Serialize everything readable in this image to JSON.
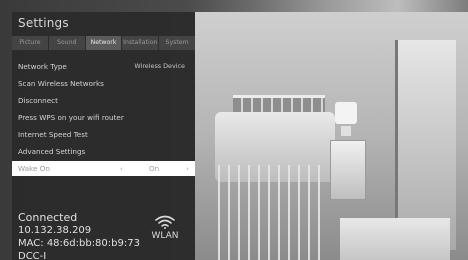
{
  "settings": {
    "title": "Settings",
    "tabs": [
      {
        "label": "Picture",
        "active": false
      },
      {
        "label": "Sound",
        "active": false
      },
      {
        "label": "Network",
        "active": true
      },
      {
        "label": "Installation",
        "active": false
      },
      {
        "label": "System",
        "active": false
      }
    ],
    "menu": [
      {
        "label": "Network Type",
        "value": "Wireless Device"
      },
      {
        "label": "Scan Wireless Networks",
        "value": ""
      },
      {
        "label": "Disconnect",
        "value": ""
      },
      {
        "label": "Press WPS on your wifi router",
        "value": ""
      },
      {
        "label": "Internet Speed Test",
        "value": ""
      },
      {
        "label": "Advanced Settings",
        "value": ""
      }
    ],
    "wake_on": {
      "label": "Wake On",
      "left_arrow": "‹",
      "value": "On",
      "right_arrow": "›"
    },
    "status": {
      "connection": "Connected",
      "ip": "10.132.38.209",
      "mac": "MAC: 48:6d:bb:80:b9:73",
      "partial_line": "DCC-I",
      "network_label": "WLAN",
      "network_icon": "wifi-icon"
    }
  }
}
